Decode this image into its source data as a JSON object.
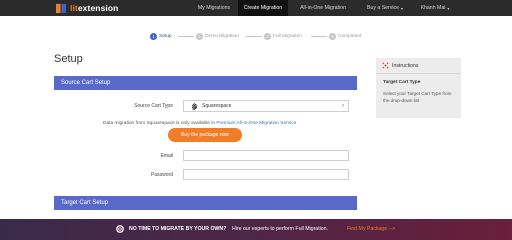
{
  "nav": {
    "logo_prefix": "lit",
    "logo_suffix": "extension",
    "items": [
      {
        "label": "My Migrations"
      },
      {
        "label": "Create Migration"
      },
      {
        "label": "All-in-One Migration"
      },
      {
        "label": "Buy a Service",
        "caret": "▾"
      },
      {
        "label": "Khanh Mai",
        "caret": "▾"
      }
    ],
    "active_index": 1
  },
  "steps": [
    {
      "num": "1",
      "label": "Setup"
    },
    {
      "num": "2",
      "label": "Demo Migration"
    },
    {
      "num": "3",
      "label": "Full Migration"
    },
    {
      "num": "4",
      "label": "Completed"
    }
  ],
  "page_title": "Setup",
  "source_section": {
    "title": "Source Cart Setup",
    "cart_type_label": "Source Cart Type",
    "cart_type_value": "Squarespace",
    "notice_text": "Data migration from Squarespace is only available in ",
    "notice_link": "Premium All-in-One Migration Service",
    "buy_button": "Buy the package now",
    "email_label": "Email",
    "email_value": "",
    "password_label": "Password",
    "password_value": ""
  },
  "target_section": {
    "title": "Target Cart Setup"
  },
  "instructions": {
    "title": "Instructions",
    "subtitle": "Target Cart Type",
    "body": "Select your Target Cart Type from the drop-down list"
  },
  "banner": {
    "text_bold": "NO TIME TO MIGRATE BY YOUR OWN?",
    "text_rest": "Hire our experts to perform Full Migration.",
    "link": "Find My Package -->"
  },
  "colors": {
    "accent_blue": "#5969ca",
    "orange": "#f07d2a",
    "nav_bg": "#2b2b2b"
  }
}
